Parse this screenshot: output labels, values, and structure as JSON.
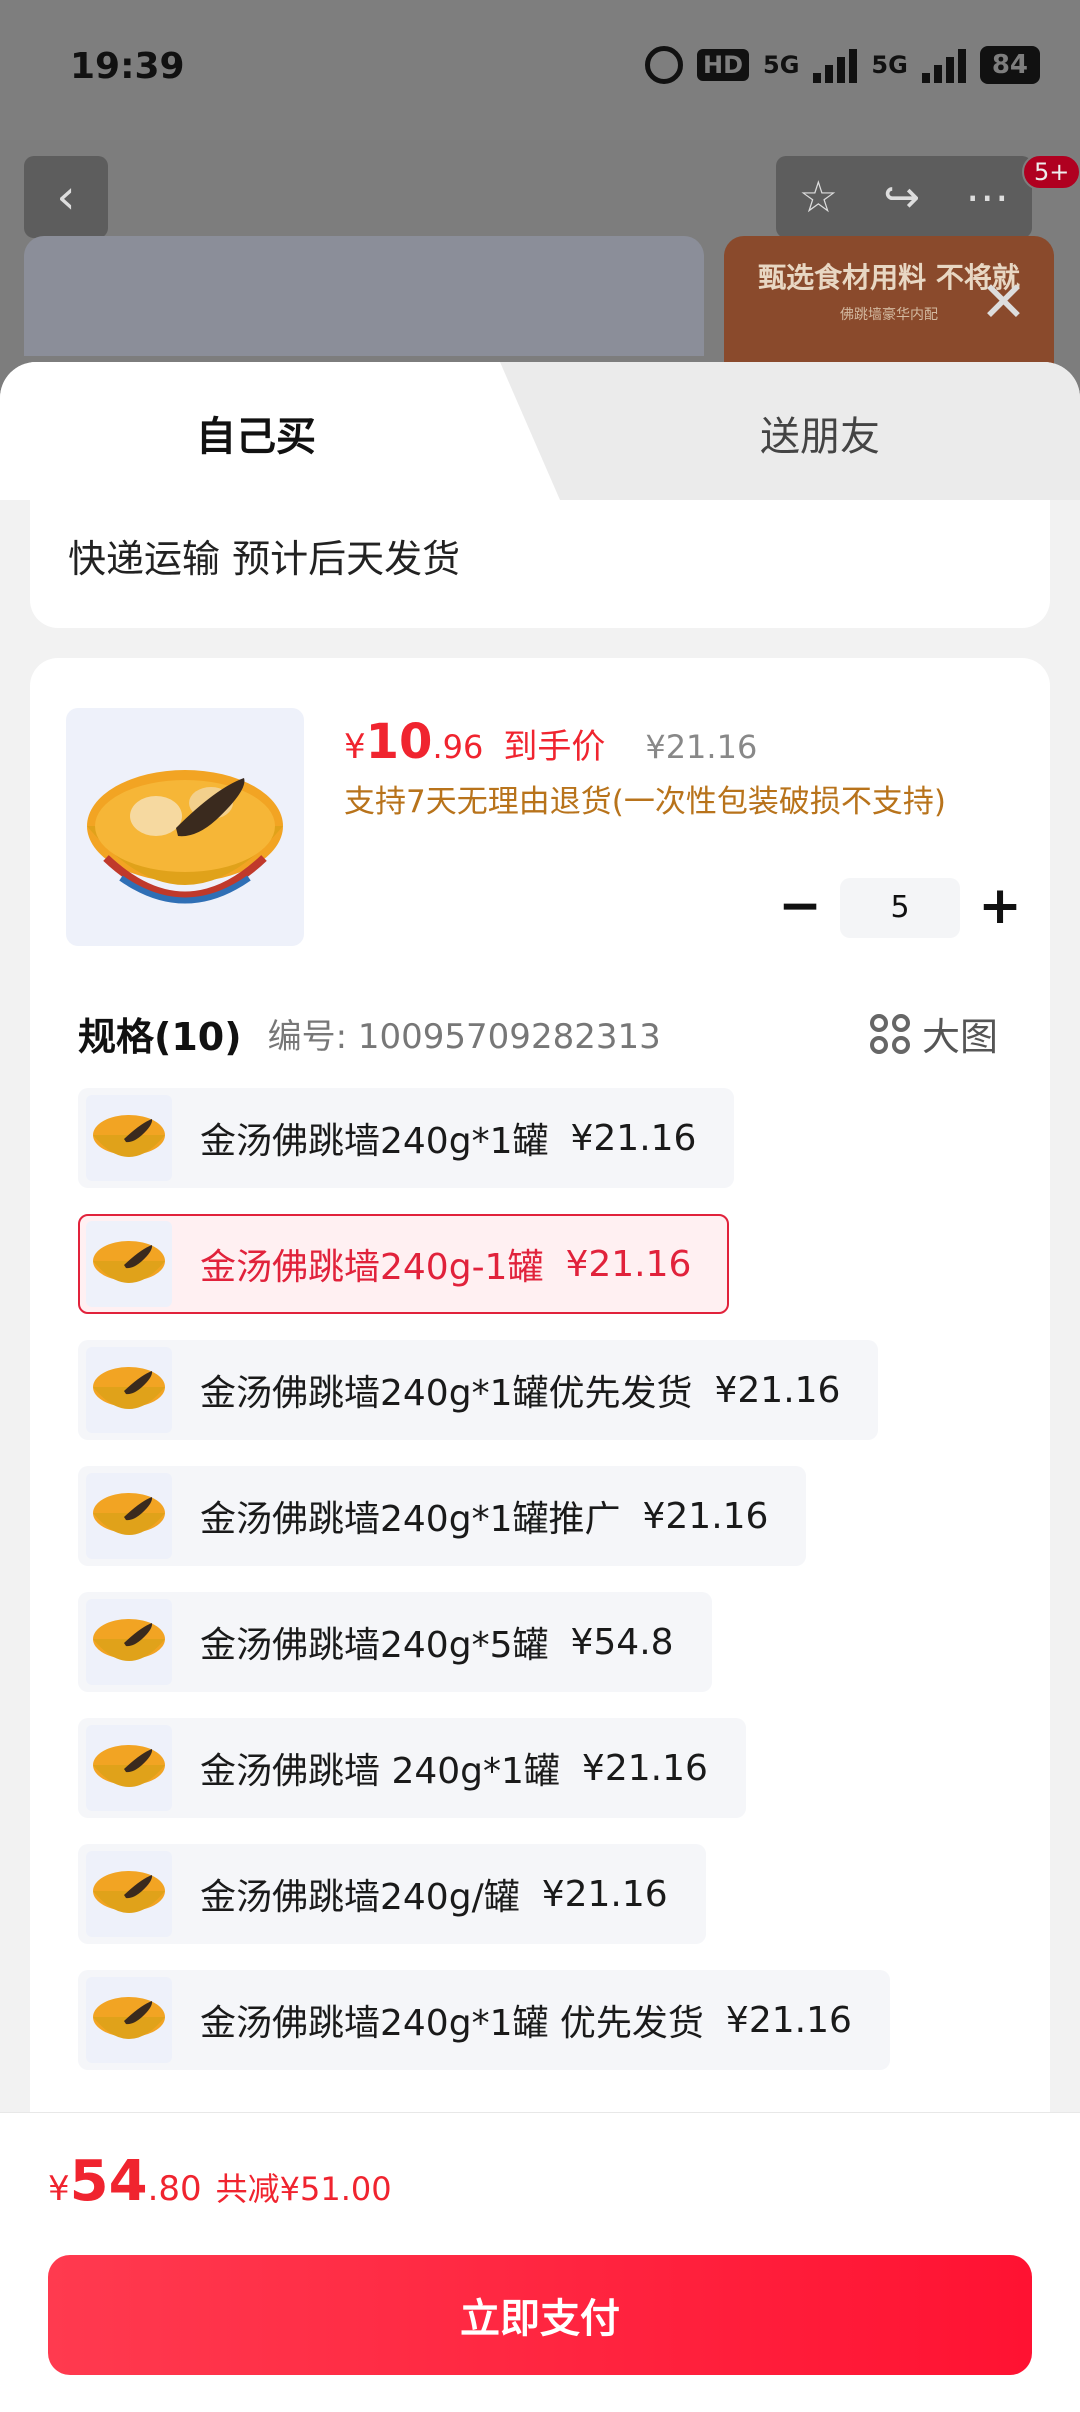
{
  "status_bar": {
    "time": "19:39",
    "hd_label": "HD",
    "net1": "5G",
    "net2": "5G",
    "battery": "84"
  },
  "background": {
    "badge": "5+",
    "banner_title": "甄选食材用料 不将就",
    "banner_sub": "佛跳墙豪华内配"
  },
  "tabs": {
    "self": "自己买",
    "friend": "送朋友"
  },
  "shipping": "快递运输 预计后天发货",
  "product": {
    "price_symbol": "¥",
    "price_int": "10",
    "price_dec": ".96",
    "price_tag": "到手价",
    "orig_price": "¥21.16",
    "return_note": "支持7天无理由退货(一次性包装破损不支持)",
    "quantity": "5",
    "minus": "−",
    "plus": "+"
  },
  "spec": {
    "title": "规格(10)",
    "code": "编号: 10095709282313",
    "big_view": "大图"
  },
  "specs": [
    {
      "name": "金汤佛跳墙240g*1罐",
      "price": "¥21.16"
    },
    {
      "name": "金汤佛跳墙240g-1罐",
      "price": "¥21.16"
    },
    {
      "name": "金汤佛跳墙240g*1罐优先发货",
      "price": "¥21.16"
    },
    {
      "name": "金汤佛跳墙240g*1罐推广",
      "price": "¥21.16"
    },
    {
      "name": "金汤佛跳墙240g*5罐",
      "price": "¥54.8"
    },
    {
      "name": "金汤佛跳墙 240g*1罐",
      "price": "¥21.16"
    },
    {
      "name": "金汤佛跳墙240g/罐",
      "price": "¥21.16"
    },
    {
      "name": "金汤佛跳墙240g*1罐 优先发货",
      "price": "¥21.16"
    }
  ],
  "footer": {
    "yen": "¥",
    "total_int": "54",
    "total_dec": ".80",
    "savings": "共减¥51.00",
    "pay_label": "立即支付"
  },
  "colors": {
    "accent": "#f0242f",
    "selected_border": "#e1223b",
    "note": "#b8731b"
  }
}
